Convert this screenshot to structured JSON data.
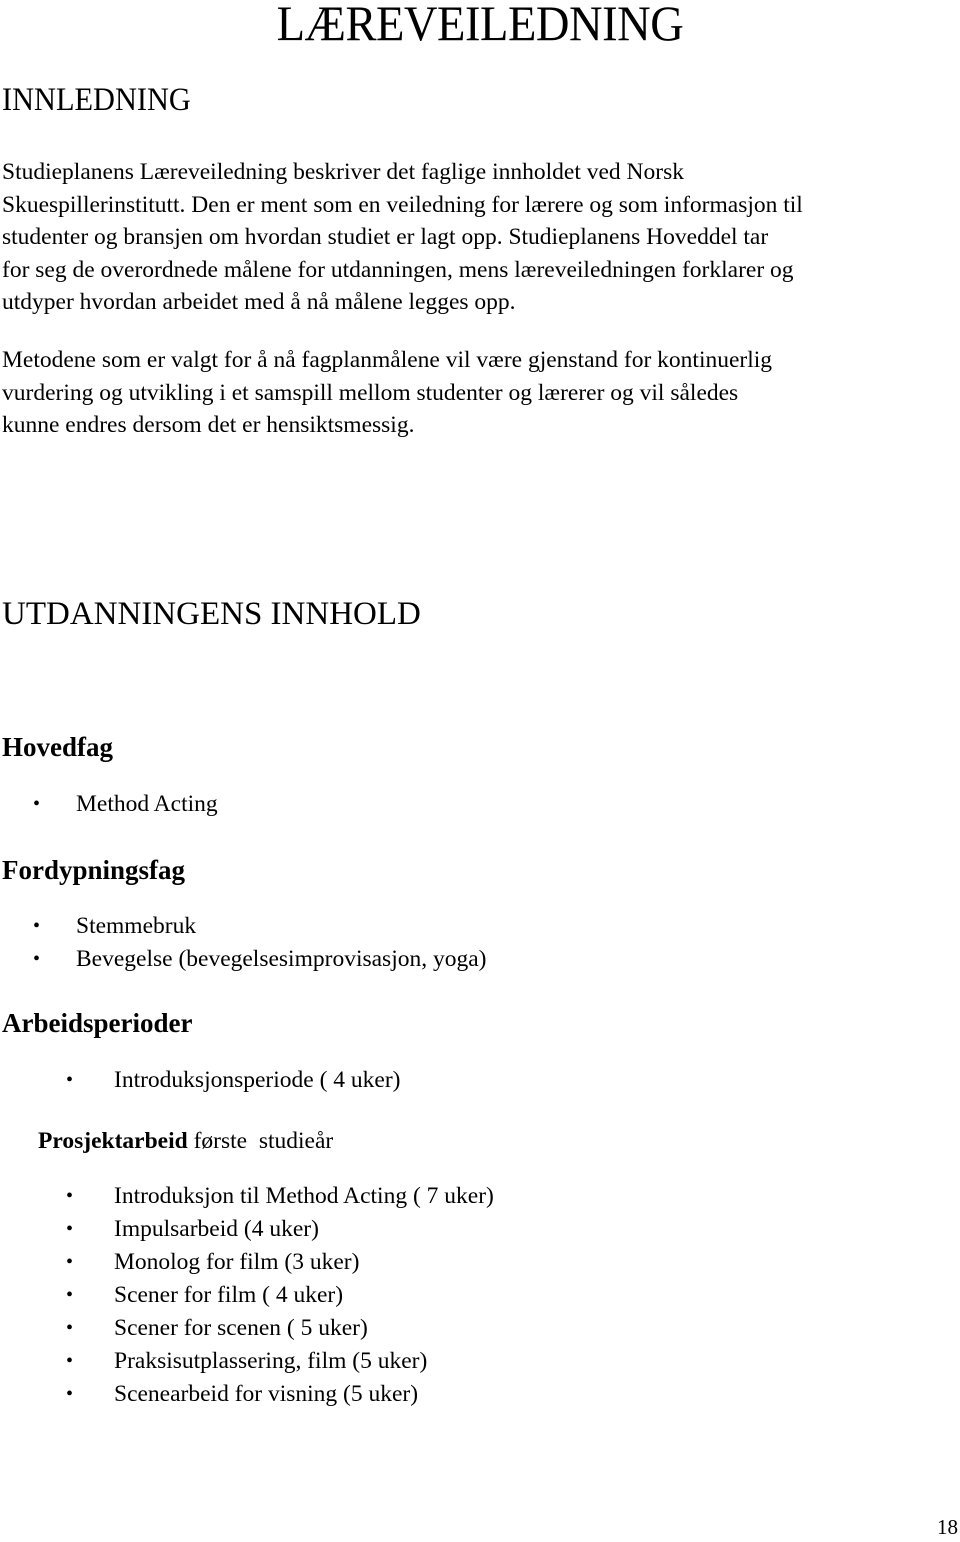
{
  "document": {
    "title": "LÆREVEILEDNING",
    "page_number": "18"
  },
  "innledning": {
    "heading": "INNLEDNING",
    "paragraph1_lines": [
      "Studieplanens Læreveiledning beskriver det faglige innholdet ved Norsk",
      "Skuespillerinstitutt. Den er ment som en veiledning for lærere og som informasjon til",
      "studenter og bransjen om hvordan studiet er lagt opp. Studieplanens Hoveddel tar",
      "for seg de overordnede målene for utdanningen, mens læreveiledningen forklarer og",
      "utdyper hvordan arbeidet med å nå målene legges opp."
    ],
    "paragraph2_lines": [
      "Metodene som er valgt for å nå fagplanmålene vil være gjenstand for kontinuerlig",
      "vurdering og utvikling i et samspill mellom studenter og lærerer og vil således",
      "kunne endres dersom det er hensiktsmessig."
    ]
  },
  "utdanningens_innhold": {
    "heading": "UTDANNINGENS INNHOLD",
    "hovedfag": {
      "heading": "Hovedfag",
      "items": [
        "Method Acting"
      ]
    },
    "fordypningsfag": {
      "heading": "Fordypningsfag",
      "items": [
        "Stemmebruk",
        "Bevegelse (bevegelsesimprovisasjon, yoga)"
      ]
    },
    "arbeidsperioder": {
      "heading": "Arbeidsperioder",
      "items": [
        "Introduksjonsperiode ( 4 uker)"
      ]
    },
    "prosjektarbeid": {
      "heading_bold": "Prosjektarbeid",
      "heading_rest": " første  studieår",
      "items": [
        "Introduksjon til Method Acting ( 7 uker)",
        "Impulsarbeid (4 uker)",
        "Monolog for film (3 uker)",
        "Scener for film ( 4 uker)",
        "Scener for scenen ( 5 uker)",
        "Praksisutplassering, film (5 uker)",
        "Scenearbeid for visning (5 uker)"
      ]
    },
    "bullet_glyph": "•"
  }
}
